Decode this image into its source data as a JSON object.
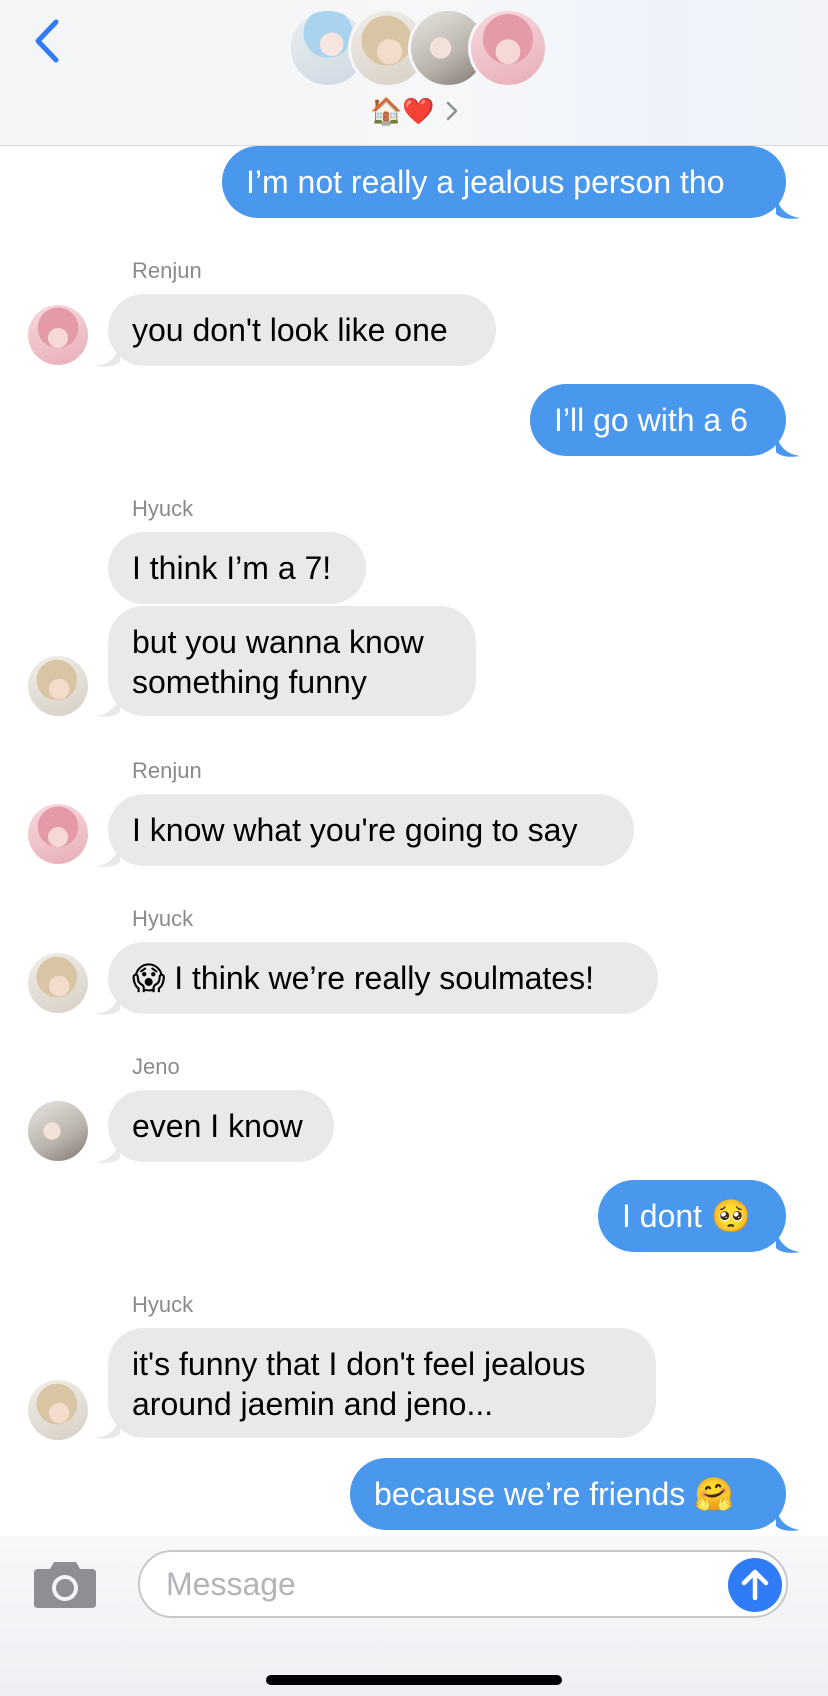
{
  "header": {
    "group_name_emoji": "🏠❤️",
    "avatars": [
      "avatar-blue-hair",
      "avatar-blond-hair",
      "avatar-white-shirt",
      "avatar-pink-hair"
    ]
  },
  "messages": [
    {
      "id": "m1",
      "direction": "out",
      "text": "I’m not really a jealous person tho"
    },
    {
      "id": "m2",
      "direction": "in",
      "sender": "Renjun",
      "text": "you don't look like one"
    },
    {
      "id": "m3",
      "direction": "out",
      "text": "I’ll go with a 6"
    },
    {
      "id": "m4",
      "direction": "in",
      "sender": "Hyuck",
      "text": "I think I’m a 7!"
    },
    {
      "id": "m5",
      "direction": "in",
      "text_line1": "but you wanna know",
      "text_line2": "something funny"
    },
    {
      "id": "m6",
      "direction": "in",
      "sender": "Renjun",
      "text": "I know what you're going to say"
    },
    {
      "id": "m7",
      "direction": "in",
      "sender": "Hyuck",
      "text": "😱 I think we’re really soulmates!"
    },
    {
      "id": "m8",
      "direction": "in",
      "sender": "Jeno",
      "text": "even I know"
    },
    {
      "id": "m9",
      "direction": "out",
      "text": "I dont 🥺"
    },
    {
      "id": "m10",
      "direction": "in",
      "sender": "Hyuck",
      "text_line1": "it's funny that I don't feel jealous",
      "text_line2": "around jaemin and jeno..."
    },
    {
      "id": "m11",
      "direction": "out",
      "text": "because we’re friends 🤗"
    }
  ],
  "composer": {
    "placeholder": "Message"
  },
  "colors": {
    "outgoing_bubble": "#4a98ee",
    "incoming_bubble": "#e9e9eb",
    "accent": "#2f7cf6"
  }
}
